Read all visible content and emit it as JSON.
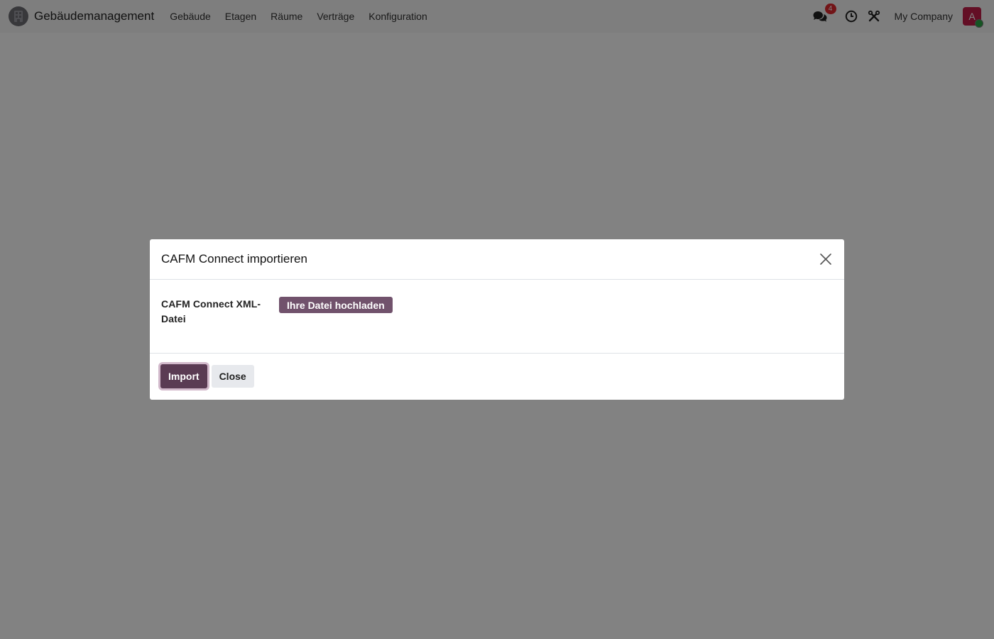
{
  "navbar": {
    "app_icon": "building-icon",
    "app_name": "Gebäudemanagement",
    "menu": [
      {
        "label": "Gebäude"
      },
      {
        "label": "Etagen"
      },
      {
        "label": "Räume"
      },
      {
        "label": "Verträge"
      },
      {
        "label": "Konfiguration"
      }
    ],
    "messages_icon": "chat-icon",
    "messages_count": "4",
    "activity_icon": "clock-icon",
    "debug_icon": "tools-icon",
    "company": "My Company",
    "avatar_initial": "A",
    "avatar_color": "#c21e4a"
  },
  "dialog": {
    "title": "CAFM Connect importieren",
    "close_icon": "close-icon",
    "field_label": "CAFM Connect XML-Datei",
    "upload_label": "Ihre Datei hochladen",
    "import_label": "Import",
    "close_label": "Close"
  },
  "colors": {
    "primary": "#5a3b53",
    "upload": "#71526c",
    "badge": "#e0282e",
    "online": "#2aa845"
  }
}
